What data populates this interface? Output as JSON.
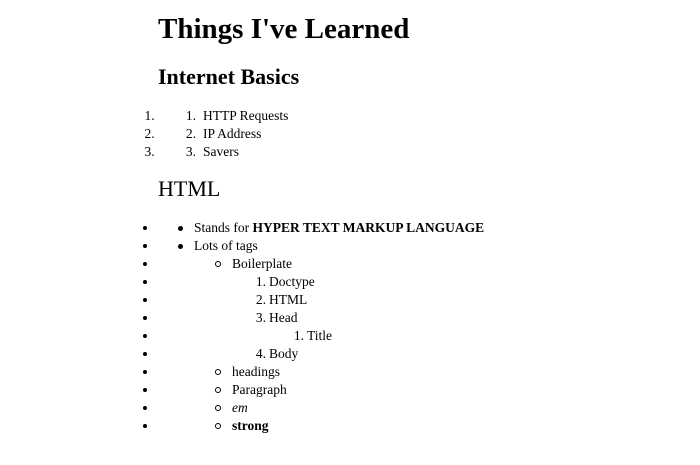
{
  "page": {
    "title": "Things I've Learned"
  },
  "internet_basics": {
    "heading": "Internet Basics",
    "items": [
      "HTTP Requests",
      "IP Address",
      "Savers"
    ]
  },
  "html_section": {
    "heading": "HTML",
    "stands_for_prefix": "Stands for ",
    "stands_for_bold": "HYPER TEXT MARKUP LANGUAGE",
    "lots_of_tags": "Lots of tags",
    "tags": {
      "boilerplate": "Boilerplate",
      "boilerplate_items": [
        "Doctype",
        "HTML",
        "Head",
        "Body"
      ],
      "head_items": [
        "Title"
      ],
      "headings": "headings",
      "paragraph": "Paragraph",
      "em": "em",
      "strong": "strong"
    }
  }
}
